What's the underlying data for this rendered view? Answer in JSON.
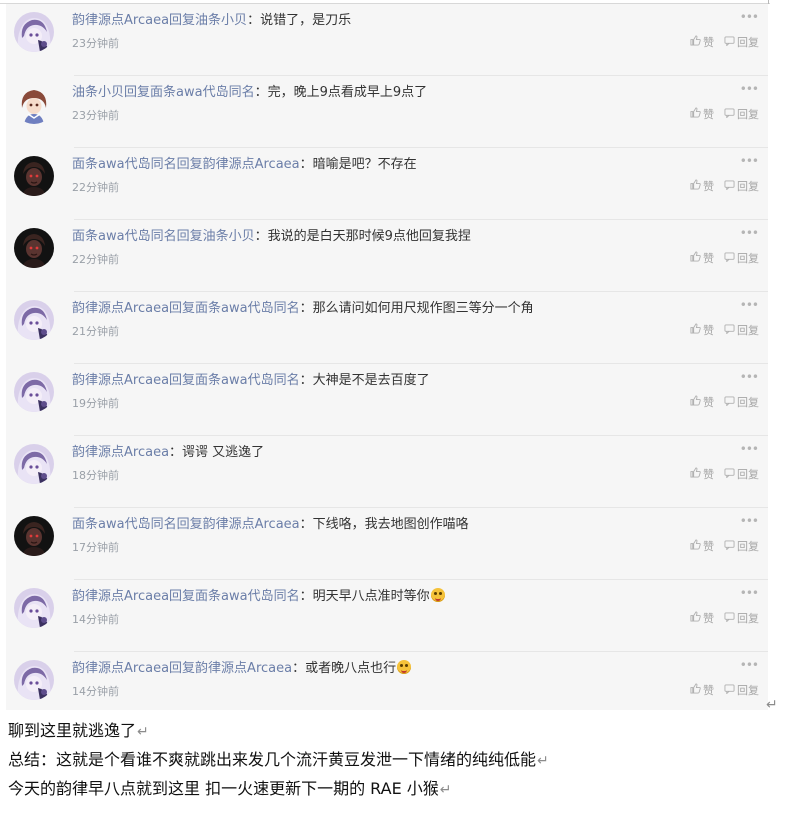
{
  "comments": [
    {
      "user": "韵律源点Arcaea",
      "action": "回复",
      "target": "油条小贝",
      "colon": "：",
      "content": "说错了，是刀乐",
      "emoji": false,
      "time": "23分钟前",
      "avatar": "purple-hair",
      "like": "赞",
      "reply": "回复"
    },
    {
      "user": "油条小贝",
      "action": "回复",
      "target": "面条awa代岛同名",
      "colon": "：",
      "content": "完，晚上9点看成早上9点了",
      "emoji": false,
      "time": "23分钟前",
      "avatar": "brown-hair",
      "like": "赞",
      "reply": "回复"
    },
    {
      "user": "面条awa代岛同名",
      "action": "回复",
      "target": "韵律源点Arcaea",
      "colon": "：",
      "content": "暗喻是吧？不存在",
      "emoji": false,
      "time": "22分钟前",
      "avatar": "dark-red",
      "like": "赞",
      "reply": "回复"
    },
    {
      "user": "面条awa代岛同名",
      "action": "回复",
      "target": "油条小贝",
      "colon": "：",
      "content": "我说的是白天那时候9点他回复我捏",
      "emoji": false,
      "time": "22分钟前",
      "avatar": "dark-red",
      "like": "赞",
      "reply": "回复"
    },
    {
      "user": "韵律源点Arcaea",
      "action": "回复",
      "target": "面条awa代岛同名",
      "colon": "：",
      "content": "那么请问如何用尺规作图三等分一个角",
      "emoji": false,
      "time": "21分钟前",
      "avatar": "purple-hair",
      "like": "赞",
      "reply": "回复"
    },
    {
      "user": "韵律源点Arcaea",
      "action": "回复",
      "target": "面条awa代岛同名",
      "colon": "：",
      "content": "大神是不是去百度了",
      "emoji": false,
      "time": "19分钟前",
      "avatar": "purple-hair",
      "like": "赞",
      "reply": "回复"
    },
    {
      "user": "韵律源点Arcaea",
      "action": "",
      "target": "",
      "colon": "：",
      "content": "谔谔 又逃逸了",
      "emoji": false,
      "time": "18分钟前",
      "avatar": "purple-hair",
      "like": "赞",
      "reply": "回复"
    },
    {
      "user": "面条awa代岛同名",
      "action": "回复",
      "target": "韵律源点Arcaea",
      "colon": "：",
      "content": "下线咯，我去地图创作喵咯",
      "emoji": false,
      "time": "17分钟前",
      "avatar": "dark-red",
      "like": "赞",
      "reply": "回复"
    },
    {
      "user": "韵律源点Arcaea",
      "action": "回复",
      "target": "面条awa代岛同名",
      "colon": "：",
      "content": "明天早八点准时等你",
      "emoji": true,
      "time": "14分钟前",
      "avatar": "purple-hair",
      "like": "赞",
      "reply": "回复"
    },
    {
      "user": "韵律源点Arcaea",
      "action": "回复",
      "target": "韵律源点Arcaea",
      "colon": "：",
      "content": "或者晚八点也行",
      "emoji": true,
      "time": "14分钟前",
      "avatar": "purple-hair",
      "like": "赞",
      "reply": "回复"
    }
  ],
  "more_glyph": "•••",
  "paragraph_mark": "↵",
  "doc": {
    "line1": "聊到这里就逃逸了",
    "line2": "总结：这就是个看谁不爽就跳出来发几个流汗黄豆发泄一下情绪的纯纯低能",
    "line3": "今天的韵律早八点就到这里  扣一火速更新下一期的 RAE 小猴"
  },
  "colors": {
    "username": "#6b7ea8",
    "panel_bg": "#f6f6f6",
    "meta": "#9aa0a8"
  }
}
